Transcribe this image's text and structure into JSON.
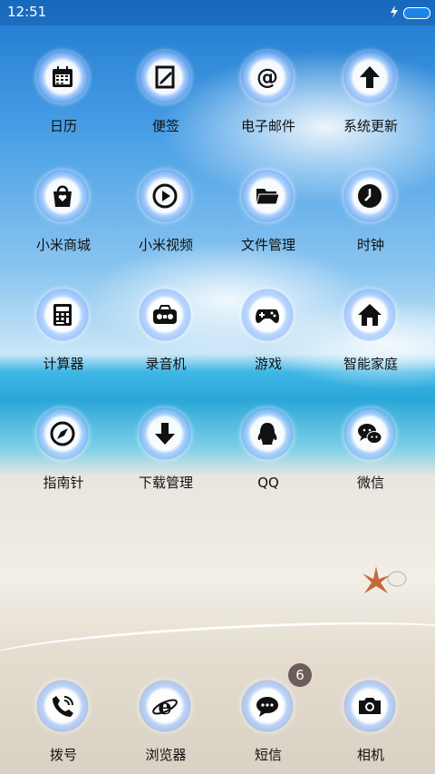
{
  "status_bar": {
    "time": "12:51"
  },
  "apps": [
    {
      "label": "日历",
      "icon": "calendar-icon"
    },
    {
      "label": "便签",
      "icon": "notes-icon"
    },
    {
      "label": "电子邮件",
      "icon": "email-at-icon"
    },
    {
      "label": "系统更新",
      "icon": "update-arrow-icon"
    },
    {
      "label": "小米商城",
      "icon": "shopping-bag-icon"
    },
    {
      "label": "小米视频",
      "icon": "play-icon"
    },
    {
      "label": "文件管理",
      "icon": "folder-icon"
    },
    {
      "label": "时钟",
      "icon": "clock-icon"
    },
    {
      "label": "计算器",
      "icon": "calculator-icon"
    },
    {
      "label": "录音机",
      "icon": "radio-icon"
    },
    {
      "label": "游戏",
      "icon": "gamepad-icon"
    },
    {
      "label": "智能家庭",
      "icon": "home-icon"
    },
    {
      "label": "指南针",
      "icon": "compass-icon"
    },
    {
      "label": "下载管理",
      "icon": "download-icon"
    },
    {
      "label": "QQ",
      "icon": "qq-penguin-icon"
    },
    {
      "label": "微信",
      "icon": "wechat-icon"
    }
  ],
  "dock": [
    {
      "label": "拨号",
      "icon": "phone-icon"
    },
    {
      "label": "浏览器",
      "icon": "browser-icon"
    },
    {
      "label": "短信",
      "icon": "message-icon",
      "badge": "6"
    },
    {
      "label": "相机",
      "icon": "camera-icon"
    }
  ],
  "colors": {
    "sky": "#1f78cf",
    "sand": "#efe9df",
    "badge": "#6d5d5a"
  }
}
